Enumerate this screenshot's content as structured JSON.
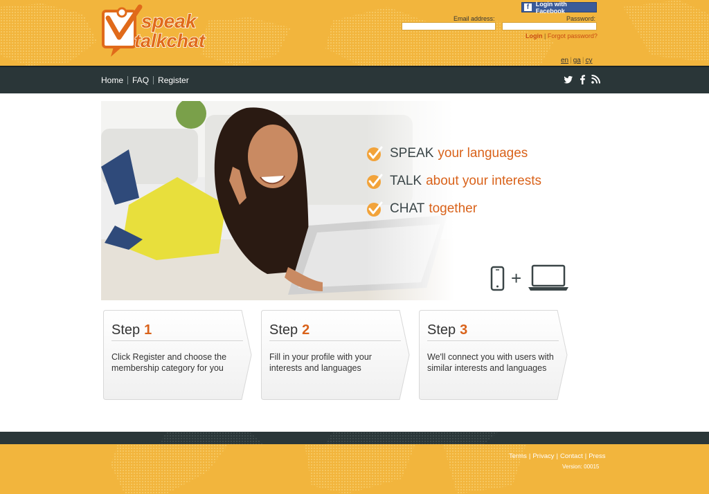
{
  "brand": {
    "logo_line1": "speak",
    "logo_line2": "talkchat"
  },
  "login": {
    "facebook_label": "Login with Facebook",
    "email_label": "Email address:",
    "password_label": "Password:",
    "email_value": "",
    "password_value": "",
    "login_link": "Login",
    "separator": "|",
    "forgot_link": "Forgot password?"
  },
  "languages": [
    "en",
    "ga",
    "cy"
  ],
  "nav": {
    "items": [
      "Home",
      "FAQ",
      "Register"
    ],
    "social_icons": [
      "twitter-icon",
      "facebook-icon",
      "rss-icon"
    ]
  },
  "hero": {
    "features": [
      {
        "keyword": "SPEAK",
        "rest": "your languages"
      },
      {
        "keyword": "TALK",
        "rest": "about your interests"
      },
      {
        "keyword": "CHAT",
        "rest": "together"
      }
    ],
    "devices_plus": "+"
  },
  "steps": [
    {
      "label": "Step",
      "number": "1",
      "text": "Click Register and choose the membership category for you"
    },
    {
      "label": "Step",
      "number": "2",
      "text": "Fill in your profile with your interests and languages"
    },
    {
      "label": "Step",
      "number": "3",
      "text": "We'll connect you with users with similar interests and languages"
    }
  ],
  "footer": {
    "links": [
      "Terms",
      "Privacy",
      "Contact",
      "Press"
    ],
    "separator": "|",
    "version": "Version: 00015"
  },
  "colors": {
    "header_yellow": "#f2b53d",
    "nav_dark": "#2a3638",
    "accent_orange": "#d9621a",
    "facebook_blue": "#3b5b99"
  }
}
